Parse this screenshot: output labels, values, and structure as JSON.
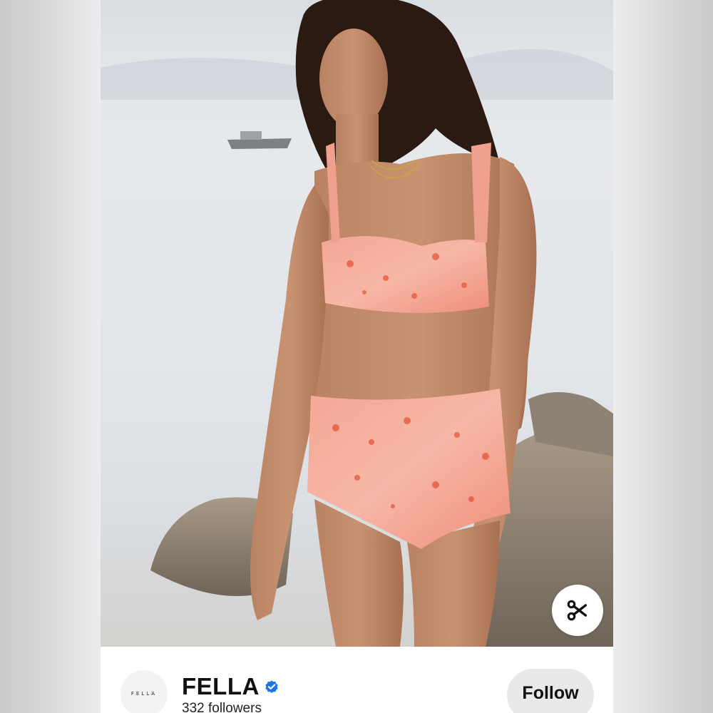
{
  "pin": {
    "image_description_icon": "person-photo",
    "action_icon": "scissors-icon"
  },
  "profile": {
    "avatar_text": "FELLA",
    "name": "FELLA",
    "verified_icon": "verified-badge-icon",
    "followers": "332 followers",
    "follow_label": "Follow"
  },
  "colors": {
    "verified_blue": "#1d73e8",
    "follow_bg": "#e9e9e9"
  }
}
